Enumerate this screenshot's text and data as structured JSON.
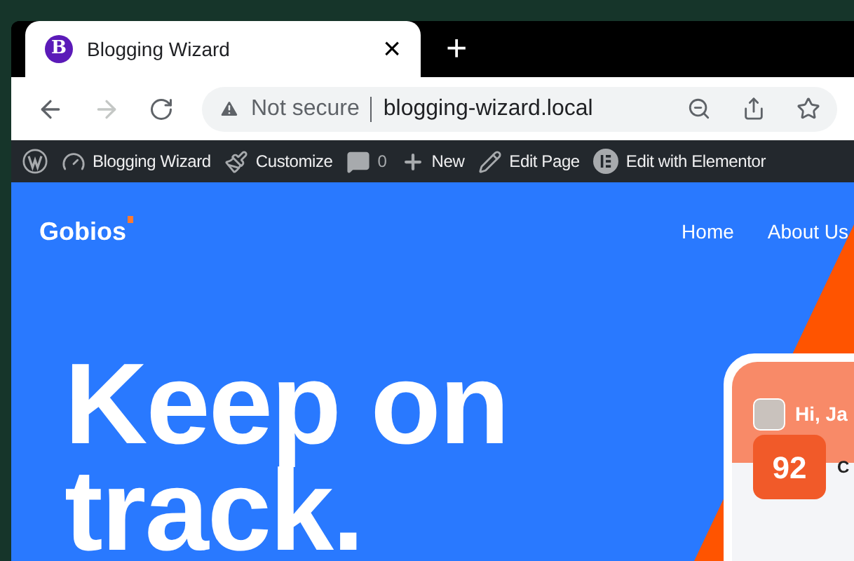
{
  "tab": {
    "favicon": "B",
    "title": "Blogging Wizard",
    "close": "×",
    "new_tab": "+"
  },
  "address_bar": {
    "security": "Not secure",
    "url": "blogging-wizard.local"
  },
  "admin_bar": {
    "items": [
      {
        "kind": "logo"
      },
      {
        "kind": "site",
        "label": "Blogging Wizard"
      },
      {
        "kind": "customize",
        "label": "Customize"
      },
      {
        "kind": "comments",
        "label": "0"
      },
      {
        "kind": "new",
        "label": "New"
      },
      {
        "kind": "edit",
        "label": "Edit Page"
      },
      {
        "kind": "elementor",
        "label": "Edit with Elementor"
      }
    ]
  },
  "site": {
    "logo": "Gobios",
    "nav": [
      "Home",
      "About Us"
    ],
    "heading": "Keep on track.",
    "phone": {
      "greeting": "Hi, Ja",
      "score": "92",
      "card_title": "C"
    }
  }
}
